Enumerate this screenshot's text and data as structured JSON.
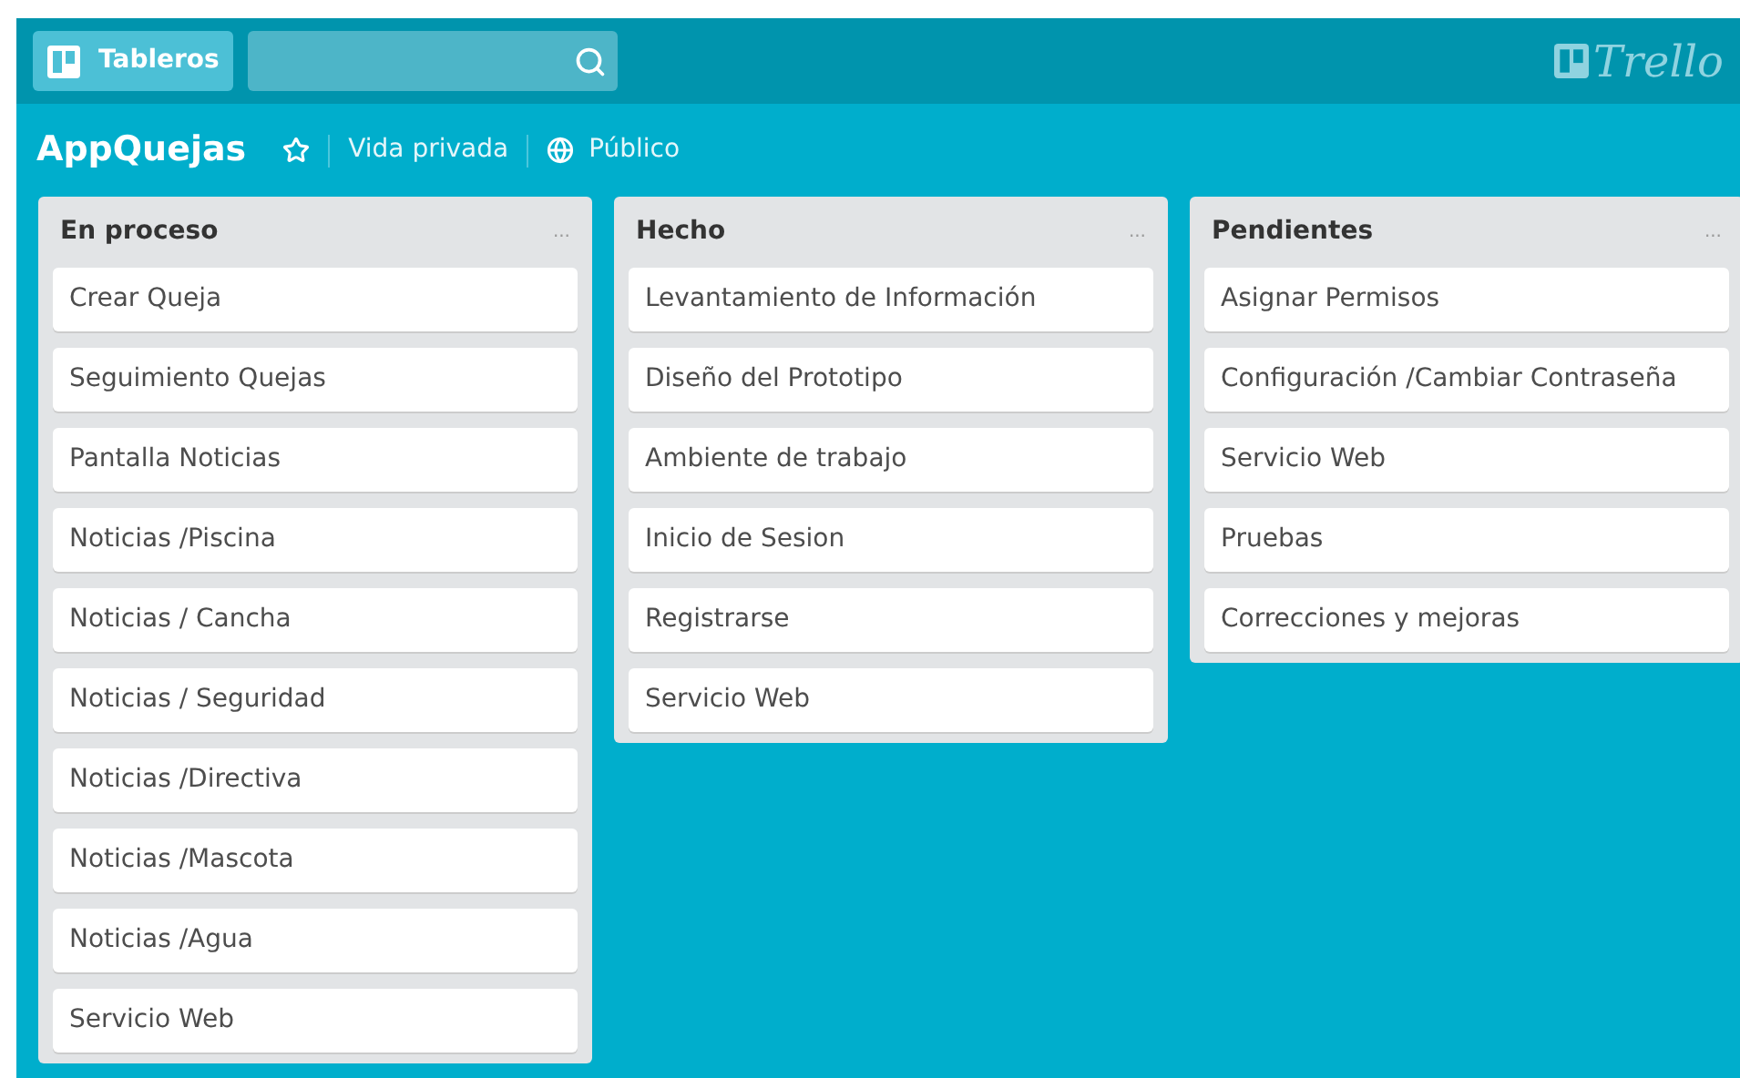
{
  "header": {
    "boards_button": "Tableros",
    "logo": "Trello"
  },
  "board": {
    "title": "AppQuejas",
    "starred": false,
    "visibility": "Vida privada",
    "team": "Público"
  },
  "lists": [
    {
      "title": "En proceso",
      "menu": "...",
      "cards": [
        "Crear Queja",
        "Seguimiento Quejas",
        "Pantalla Noticias",
        "Noticias /Piscina",
        "Noticias / Cancha",
        "Noticias / Seguridad",
        "Noticias /Directiva",
        "Noticias /Mascota",
        "Noticias /Agua",
        "Servicio Web"
      ]
    },
    {
      "title": "Hecho",
      "menu": "...",
      "cards": [
        "Levantamiento de Información",
        "Diseño del Prototipo",
        "Ambiente de trabajo",
        "Inicio de Sesion",
        "Registrarse",
        "Servicio Web"
      ]
    },
    {
      "title": "Pendientes",
      "menu": "...",
      "cards": [
        "Asignar Permisos",
        "Configuración /Cambiar Contraseña",
        "Servicio Web",
        "Pruebas",
        "Correcciones y mejoras"
      ]
    }
  ]
}
